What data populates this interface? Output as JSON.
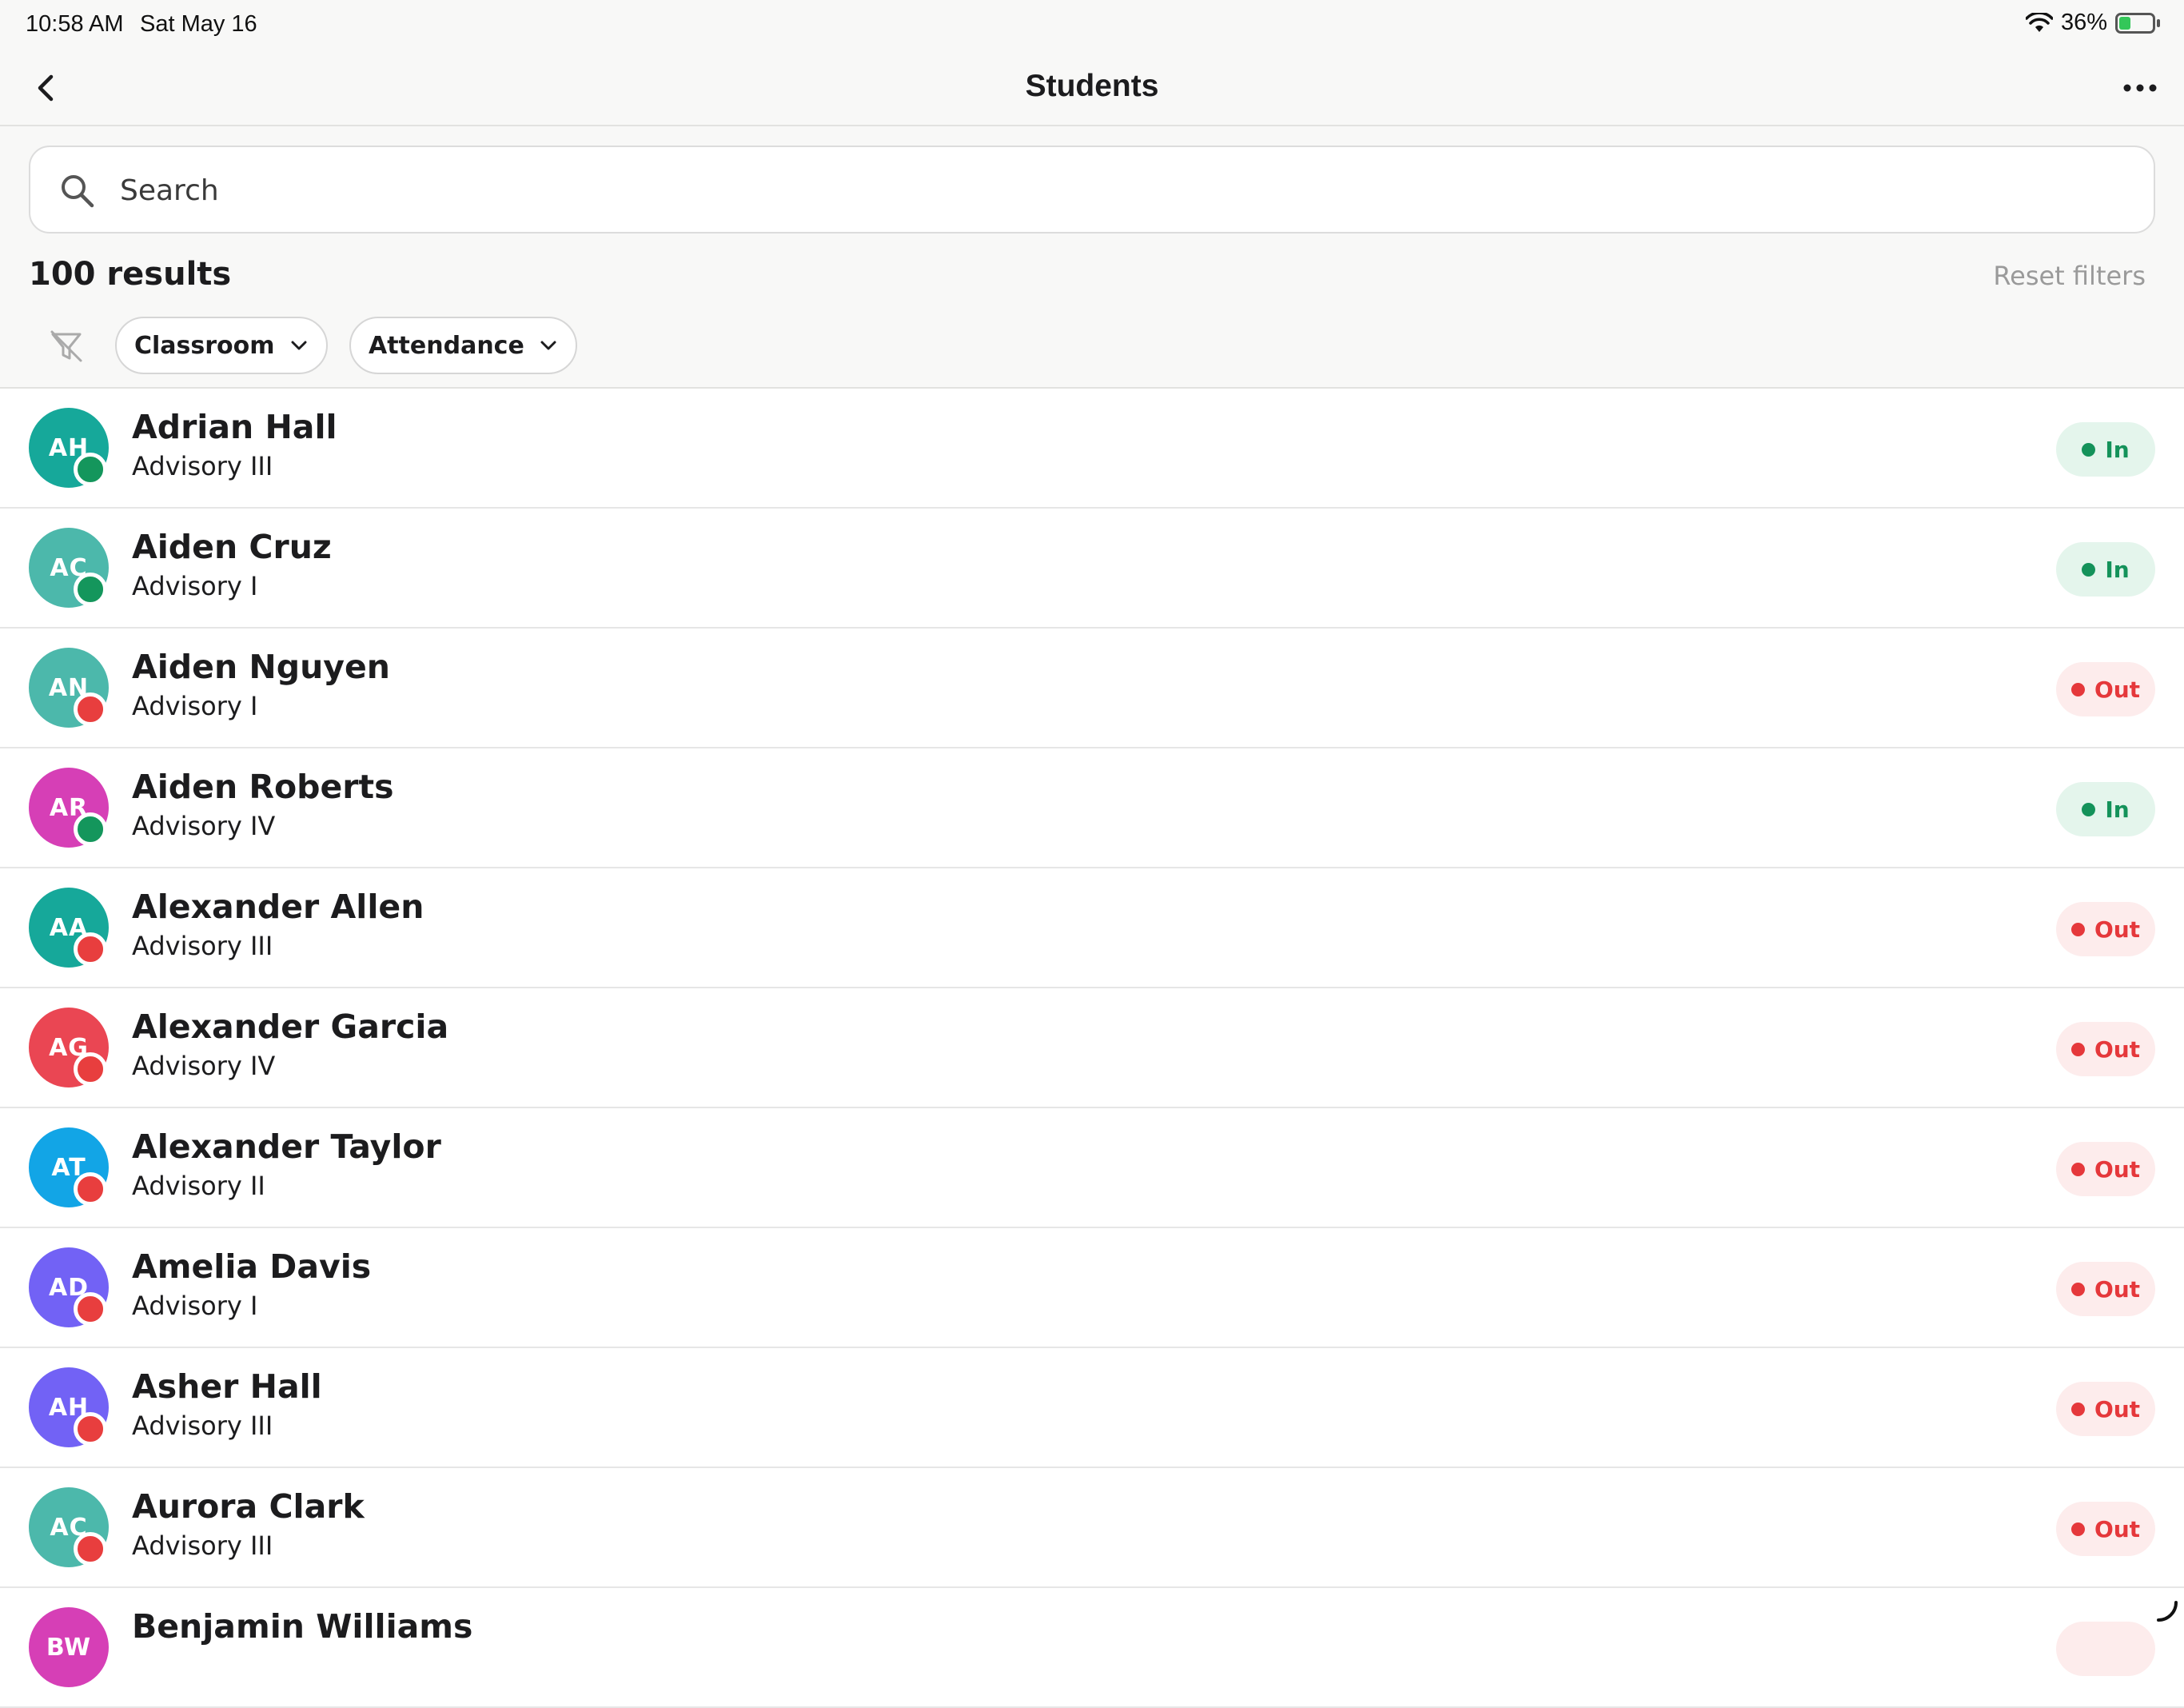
{
  "status_bar": {
    "time": "10:58 AM",
    "date": "Sat May 16",
    "battery": "36%",
    "battery_level": 0.36
  },
  "nav": {
    "title": "Students"
  },
  "search": {
    "placeholder": "Search"
  },
  "results": {
    "count_label": "100 results",
    "reset_label": "Reset filters"
  },
  "filters": {
    "classroom": "Classroom",
    "attendance": "Attendance"
  },
  "colors": {
    "in": "#14925a",
    "out": "#e5383b",
    "in_bg": "#e4f5ec",
    "out_bg": "#fdecec"
  },
  "students": [
    {
      "initials": "AH",
      "name": "Adrian Hall",
      "classroom": "Advisory III",
      "status": "In",
      "avatar_color": "#16a89a"
    },
    {
      "initials": "AC",
      "name": "Aiden Cruz",
      "classroom": "Advisory I",
      "status": "In",
      "avatar_color": "#4cb8ab"
    },
    {
      "initials": "AN",
      "name": "Aiden Nguyen",
      "classroom": "Advisory I",
      "status": "Out",
      "avatar_color": "#4cb8ab"
    },
    {
      "initials": "AR",
      "name": "Aiden Roberts",
      "classroom": "Advisory IV",
      "status": "In",
      "avatar_color": "#d63fb6"
    },
    {
      "initials": "AA",
      "name": "Alexander Allen",
      "classroom": "Advisory III",
      "status": "Out",
      "avatar_color": "#16a89a"
    },
    {
      "initials": "AG",
      "name": "Alexander Garcia",
      "classroom": "Advisory IV",
      "status": "Out",
      "avatar_color": "#ea4653"
    },
    {
      "initials": "AT",
      "name": "Alexander Taylor",
      "classroom": "Advisory II",
      "status": "Out",
      "avatar_color": "#12a5e6"
    },
    {
      "initials": "AD",
      "name": "Amelia Davis",
      "classroom": "Advisory I",
      "status": "Out",
      "avatar_color": "#7262f5"
    },
    {
      "initials": "AH",
      "name": "Asher Hall",
      "classroom": "Advisory III",
      "status": "Out",
      "avatar_color": "#7262f5"
    },
    {
      "initials": "AC",
      "name": "Aurora Clark",
      "classroom": "Advisory III",
      "status": "Out",
      "avatar_color": "#4cb8ab"
    },
    {
      "initials": "BW",
      "name": "Benjamin Williams",
      "classroom": "",
      "status": "",
      "avatar_color": "#d63fb6"
    }
  ]
}
